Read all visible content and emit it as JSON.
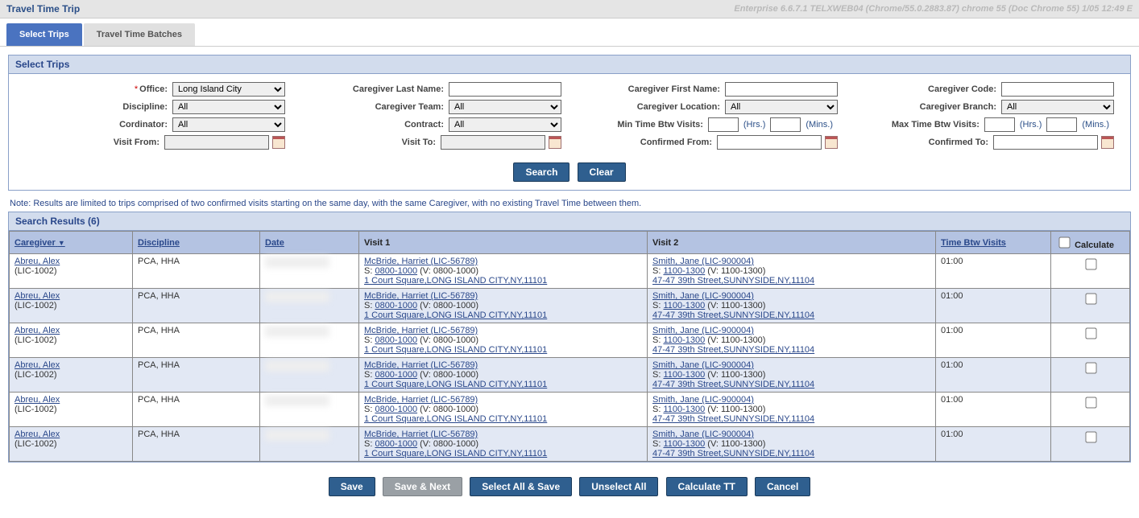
{
  "header": {
    "title": "Travel Time Trip",
    "env": "Enterprise 6.6.7.1  TELXWEB04 (Chrome/55.0.2883.87) chrome 55 (Doc Chrome 55) 1/05 12:49 E"
  },
  "tabs": {
    "select": "Select Trips",
    "batches": "Travel Time Batches"
  },
  "form": {
    "title": "Select Trips",
    "labels": {
      "office": "Office:",
      "discipline": "Discipline:",
      "coordinator": "Cordinator:",
      "visitFrom": "Visit From:",
      "cglast": "Caregiver Last Name:",
      "cgteam": "Caregiver Team:",
      "contract": "Contract:",
      "visitTo": "Visit To:",
      "cgfirst": "Caregiver First Name:",
      "cgloc": "Caregiver Location:",
      "minbtw": "Min Time Btw Visits:",
      "confFrom": "Confirmed From:",
      "cgcode": "Caregiver Code:",
      "cgbranch": "Caregiver Branch:",
      "maxbtw": "Max Time Btw Visits:",
      "confTo": "Confirmed To:"
    },
    "values": {
      "office": "Long Island City",
      "discipline": "All",
      "coordinator": "All",
      "team": "All",
      "contract": "All",
      "location": "All",
      "branch": "All"
    },
    "units": {
      "hrs": "(Hrs.)",
      "mins": "(Mins.)"
    },
    "buttons": {
      "search": "Search",
      "clear": "Clear"
    }
  },
  "note": "Note: Results are limited to trips comprised of two confirmed visits starting on the same day, with the same Caregiver, with no existing Travel Time between them.",
  "results": {
    "title": "Search Results (6)",
    "cols": {
      "caregiver": "Caregiver",
      "discipline": "Discipline",
      "date": "Date",
      "v1": "Visit 1",
      "v2": "Visit 2",
      "tbv": "Time Btw Visits",
      "calc": "Calculate"
    },
    "rows": [
      {
        "cg_name": "Abreu, Alex",
        "cg_code": "(LIC-1002)",
        "disc": "PCA, HHA",
        "v1_patient": "McBride, Harriet (LIC-56789)",
        "v1_s": "0800-1000",
        "v1_v": " (V: 0800-1000)",
        "v1_addr": "1 Court Square,LONG ISLAND CITY,NY,11101",
        "v2_patient": "Smith, Jane (LIC-900004)",
        "v2_s": "1100-1300",
        "v2_v": " (V: 1100-1300)",
        "v2_addr": "47-47 39th Street,SUNNYSIDE,NY,11104",
        "tbv": "01:00"
      },
      {
        "cg_name": "Abreu, Alex",
        "cg_code": "(LIC-1002)",
        "disc": "PCA, HHA",
        "v1_patient": "McBride, Harriet (LIC-56789)",
        "v1_s": "0800-1000",
        "v1_v": " (V: 0800-1000)",
        "v1_addr": "1 Court Square,LONG ISLAND CITY,NY,11101",
        "v2_patient": "Smith, Jane (LIC-900004)",
        "v2_s": "1100-1300",
        "v2_v": " (V: 1100-1300)",
        "v2_addr": "47-47 39th Street,SUNNYSIDE,NY,11104",
        "tbv": "01:00"
      },
      {
        "cg_name": "Abreu, Alex",
        "cg_code": "(LIC-1002)",
        "disc": "PCA, HHA",
        "v1_patient": "McBride, Harriet (LIC-56789)",
        "v1_s": "0800-1000",
        "v1_v": " (V: 0800-1000)",
        "v1_addr": "1 Court Square,LONG ISLAND CITY,NY,11101",
        "v2_patient": "Smith, Jane (LIC-900004)",
        "v2_s": "1100-1300",
        "v2_v": " (V: 1100-1300)",
        "v2_addr": "47-47 39th Street,SUNNYSIDE,NY,11104",
        "tbv": "01:00"
      },
      {
        "cg_name": "Abreu, Alex",
        "cg_code": "(LIC-1002)",
        "disc": "PCA, HHA",
        "v1_patient": "McBride, Harriet (LIC-56789)",
        "v1_s": "0800-1000",
        "v1_v": " (V: 0800-1000)",
        "v1_addr": "1 Court Square,LONG ISLAND CITY,NY,11101",
        "v2_patient": "Smith, Jane (LIC-900004)",
        "v2_s": "1100-1300",
        "v2_v": " (V: 1100-1300)",
        "v2_addr": "47-47 39th Street,SUNNYSIDE,NY,11104",
        "tbv": "01:00"
      },
      {
        "cg_name": "Abreu, Alex",
        "cg_code": "(LIC-1002)",
        "disc": "PCA, HHA",
        "v1_patient": "McBride, Harriet (LIC-56789)",
        "v1_s": "0800-1000",
        "v1_v": " (V: 0800-1000)",
        "v1_addr": "1 Court Square,LONG ISLAND CITY,NY,11101",
        "v2_patient": "Smith, Jane (LIC-900004)",
        "v2_s": "1100-1300",
        "v2_v": " (V: 1100-1300)",
        "v2_addr": "47-47 39th Street,SUNNYSIDE,NY,11104",
        "tbv": "01:00"
      },
      {
        "cg_name": "Abreu, Alex",
        "cg_code": "(LIC-1002)",
        "disc": "PCA, HHA",
        "v1_patient": "McBride, Harriet (LIC-56789)",
        "v1_s": "0800-1000",
        "v1_v": " (V: 0800-1000)",
        "v1_addr": "1 Court Square,LONG ISLAND CITY,NY,11101",
        "v2_patient": "Smith, Jane (LIC-900004)",
        "v2_s": "1100-1300",
        "v2_v": " (V: 1100-1300)",
        "v2_addr": "47-47 39th Street,SUNNYSIDE,NY,11104",
        "tbv": "01:00"
      }
    ]
  },
  "footer": {
    "save": "Save",
    "saveNext": "Save & Next",
    "selectAll": "Select All & Save",
    "unselect": "Unselect All",
    "calc": "Calculate TT",
    "cancel": "Cancel"
  }
}
